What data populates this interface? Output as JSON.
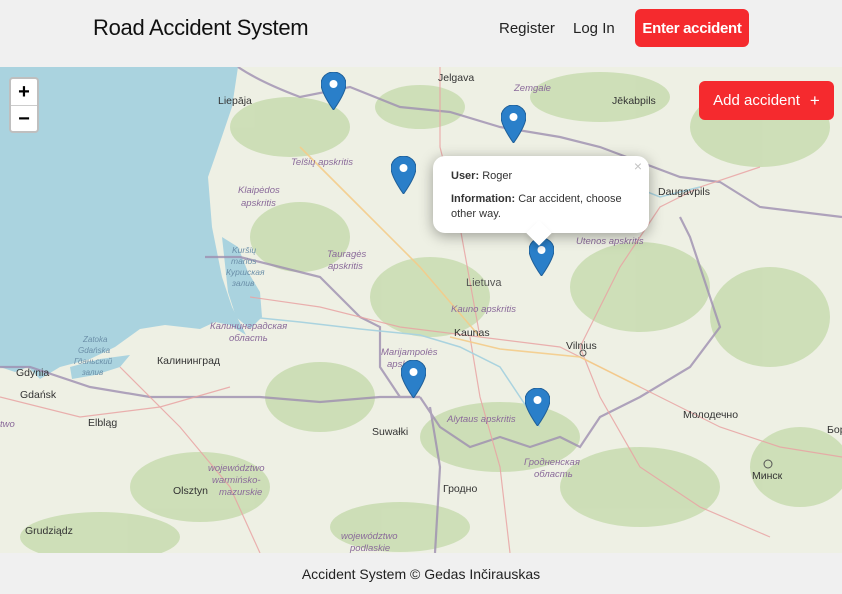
{
  "header": {
    "brand": "Road Accident System",
    "nav": {
      "register": "Register",
      "login": "Log In"
    },
    "enter_button": "Enter accident"
  },
  "map": {
    "zoom_in": "+",
    "zoom_out": "−",
    "add_button": {
      "label": "Add accident",
      "icon": "+"
    },
    "popup": {
      "user_label": "User:",
      "user_value": "Roger",
      "info_label": "Information:",
      "info_value": "Car accident, choose other way.",
      "close": "×"
    },
    "markers": [
      "accident-marker",
      "accident-marker",
      "accident-marker",
      "accident-marker",
      "accident-marker",
      "accident-marker"
    ],
    "labels": {
      "jelgava": "Jelgava",
      "zemgale": "Zemgale",
      "jekabpils": "Jēkabpils",
      "liepaja": "Liepāja",
      "telsiu": "Telšių apskritis",
      "klaipedos1": "Klaipėdos",
      "klaipedos2": "apskritis",
      "daugavpils": "Daugavpils",
      "utenos": "Utenos apskritis",
      "kursiu1": "Kuršių",
      "kursiu2": "marios",
      "kursiu3": "Куршская",
      "kursiu4": "залив",
      "taurages1": "Tauragės",
      "taurages2": "apskritis",
      "lietuva": "Lietuva",
      "kauno": "Kauno apskritis",
      "kaunas": "Kaunas",
      "vilnius": "Vilnius",
      "kalin_obl1": "Калининградская",
      "kalin_obl2": "область",
      "kaliningrad": "Калининград",
      "marijampoles1": "Marijampolės",
      "marijampoles2": "apskritis",
      "zatoka1": "Zatoka",
      "zatoka2": "Gdańska",
      "zatoka3": "Гданьский",
      "zatoka4": "залив",
      "gdynia": "Gdynia",
      "gdansk": "Gdańsk",
      "alytaus": "Alytaus apskritis",
      "molodechno": "Молодечно",
      "suwalki": "Suwałki",
      "elblag": "Elbląg",
      "grodno_obl1": "Гродненская",
      "grodno_obl2": "область",
      "minsk": "Минск",
      "warm1": "województwo",
      "warm2": "warmińsko-",
      "warm3": "mazurskie",
      "olsztyn": "Olsztyn",
      "grodno": "Гродно",
      "grudziadz": "Grudziądz",
      "podl1": "województwo",
      "podl2": "podlaskie",
      "edge_two": "two",
      "edge_bor": "Бор"
    }
  },
  "footer": {
    "text": "Accident System © Gedas Inčirauskas"
  },
  "colors": {
    "accent": "#f52a2e",
    "marker": "#2a7fc9",
    "sea": "#aad3df",
    "land": "#eef0e4",
    "forest": "#c8dcb0"
  }
}
